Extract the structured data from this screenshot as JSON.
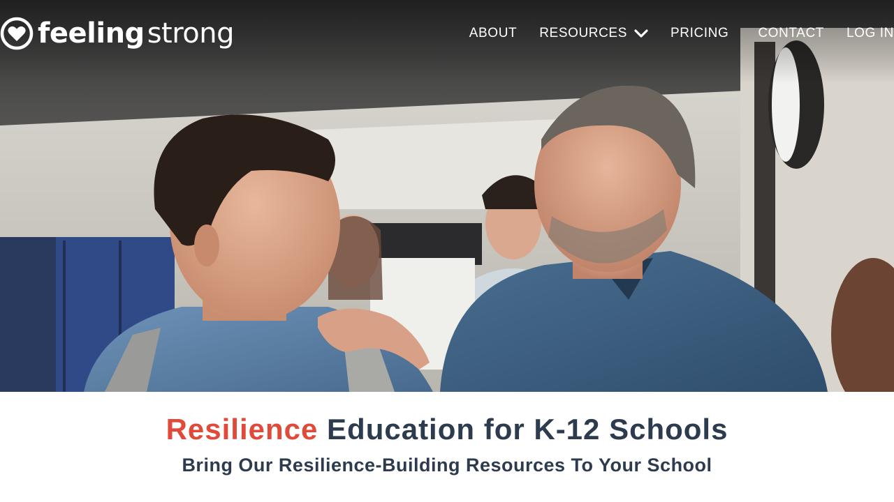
{
  "brand": {
    "name_bold": "feeling",
    "name_regular": "strong",
    "logo_icon": "heart-circle-icon"
  },
  "nav": {
    "items": [
      {
        "label": "ABOUT"
      },
      {
        "label": "RESOURCES",
        "icon": "chevron-down-icon"
      },
      {
        "label": "PRICING"
      },
      {
        "label": "CONTACT"
      },
      {
        "label": "LOG IN"
      }
    ]
  },
  "hero": {
    "image": "hero-photo-teacher-and-student-in-school-hallway"
  },
  "content": {
    "headline_accent": "Resilience",
    "headline_rest": "Education for K-12 Schools",
    "subheadline": "Bring Our Resilience-Building Resources To Your School"
  },
  "colors": {
    "accent": "#e04a3a",
    "heading": "#2d3b4e",
    "nav_text": "#ffffff"
  }
}
